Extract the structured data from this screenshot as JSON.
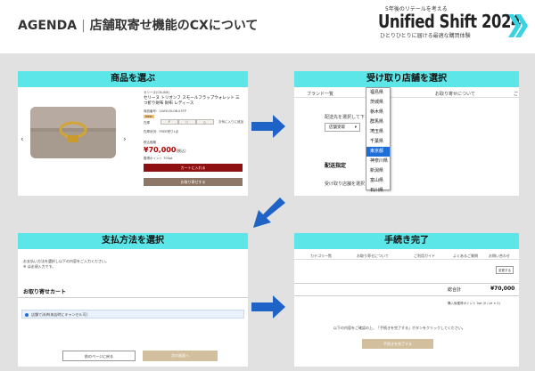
{
  "header": {
    "agenda": "AGENDA",
    "title": "店舗取寄せ機能のCXについて",
    "brand_tag": "5年後のリテールを考える",
    "brand_name": "Unified Shift 2024",
    "brand_sub": "ひとりひとりに届ける最適な購買体験"
  },
  "panels": {
    "select_product": {
      "title": "商品を選ぶ",
      "brand": "セリーヌ(CELINE)",
      "product_name": "セリーヌ トリオンフ スモールフラップウォレット 三つ折り財布 財布 レディース",
      "product_code": "商品番号：10AYU3LOB.03TP",
      "price_label": "税込価格",
      "price": "¥70,000",
      "price_tax": "(税込)",
      "point_note": "獲得ポイント 700pt",
      "size_label": "在庫",
      "size_options": [
        "F",
        "○",
        "△"
      ],
      "favorite": "お気に入りに追加",
      "cart_button": "カートに入れる",
      "ship_button": "お取り寄せする",
      "stock_note": "在庫状況：FREE残り1点",
      "badge": "New",
      "nav_prev": "‹",
      "nav_next": "›"
    },
    "select_store": {
      "title": "受け取り店舗を選択",
      "nav_brand": "ブランド一覧",
      "nav_shipping": "お取り寄せについて",
      "nav_more": "ご",
      "ship_label": "配送先を選択して下さい",
      "store_select": "店舗受取",
      "delivery_spec": "配送指定",
      "pickup_label": "受け取り店舗を選択",
      "prefectures": [
        "福島県",
        "茨城県",
        "栃木県",
        "群馬県",
        "埼玉県",
        "千葉県",
        "東京都",
        "神奈川県",
        "新潟県",
        "富山県",
        "石川県"
      ],
      "selected": "東京都"
    },
    "payment": {
      "title": "支払方法を選択",
      "note1": "お支払い方法を選択し以下の内容をご入力ください。",
      "note2": "※ は必須入力です。",
      "cart_heading": "お取り寄せカート",
      "radio_label": "店舗で決済(来店時にキャンセル可)",
      "back_button": "前のページに戻る",
      "next_button": "次の画面へ"
    },
    "complete": {
      "title": "手続き完了",
      "nav_category": "カテゴリ一覧",
      "nav_shipping": "お取り寄せについて",
      "nav_guide": "ご利用ガイド",
      "nav_faq": "よくあるご質問",
      "nav_contact": "お問い合わせ",
      "change_button": "変更する",
      "total_label": "総合計",
      "total_value": "¥70,000",
      "points_note": "購入後獲得ポイント 0pt (0 / pt × 0)",
      "confirm_note": "以下の内容をご確認の上、「手続きを完了する」ボタンをクリックしてください。",
      "complete_button": "手続きを完了する"
    }
  },
  "colors": {
    "panel_title": "#5ce6e8",
    "arrow": "#1f63c6",
    "cart_red": "#8f1010",
    "tan": "#d2bf9e",
    "selected_blue": "#1e6ed8"
  }
}
